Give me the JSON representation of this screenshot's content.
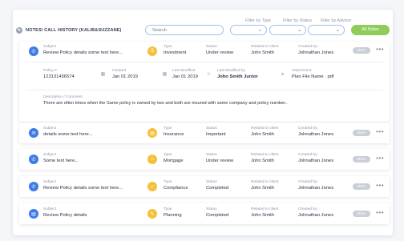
{
  "header": {
    "title": "NOTES/ CALL HISTORY (KALIB&SUZZANE)",
    "search_placeholder": "Search",
    "filter_type_label": "Filter by Type",
    "filter_status_label": "Filter by Status",
    "filter_advisor_label": "Filter by Advisor",
    "all_notes_label": "All Notes"
  },
  "labels": {
    "subject": "Subject",
    "type": "Type",
    "status": "Status",
    "related": "Related to client",
    "created_by": "Created by:",
    "more": "More",
    "dots": "•••",
    "policy_no": "Policy #",
    "created": "Created",
    "last_modified": "Last Modified",
    "last_modified_by": "Last Modified by",
    "attachment": "Attachment",
    "description": "Description / Comment"
  },
  "notes": [
    {
      "icon": "phone-icon",
      "subject": "Review Policy details some text here...",
      "type_icon": "dollar-icon",
      "type": "Investment",
      "status": "Under review",
      "client": "John Smith",
      "created_by": "Johnathan Jones",
      "details": {
        "policy_no": "123131456574",
        "created": "Jan 01 2019",
        "last_modified": "Jan 01 2019",
        "last_modified_by": "John Smith Junior",
        "attachment": "Plan File Name . pdf",
        "description": "There are often times when the Same policy is owned by two and both are insured with same company and policy number.."
      }
    },
    {
      "icon": "email-icon",
      "subject": "details some text here...",
      "type_icon": "insurance-icon",
      "type": "Insurance",
      "status": "Important",
      "client": "John Smith",
      "created_by": "Johnathan Jones"
    },
    {
      "icon": "phone-icon",
      "subject": "Some text here...",
      "type_icon": "home-icon",
      "type": "Mortgage",
      "status": "Under review",
      "client": "John Smith",
      "created_by": "Johnathan Jones"
    },
    {
      "icon": "phone-icon",
      "subject": "Review Policy details some text here...",
      "type_icon": "check-icon",
      "type": "Compliance",
      "status": "Completed",
      "client": "John Smith",
      "created_by": "Johnathan Jones"
    },
    {
      "icon": "document-icon",
      "subject": "Review Policy details",
      "type_icon": "pencil-icon",
      "type": "Planning",
      "status": "Completed",
      "client": "John Smith",
      "created_by": "Johnathan Jones"
    }
  ],
  "colors": {
    "accent_blue": "#3d7be6",
    "type_yellow": "#f5c13c",
    "all_notes_green": "#8fcc5c"
  }
}
